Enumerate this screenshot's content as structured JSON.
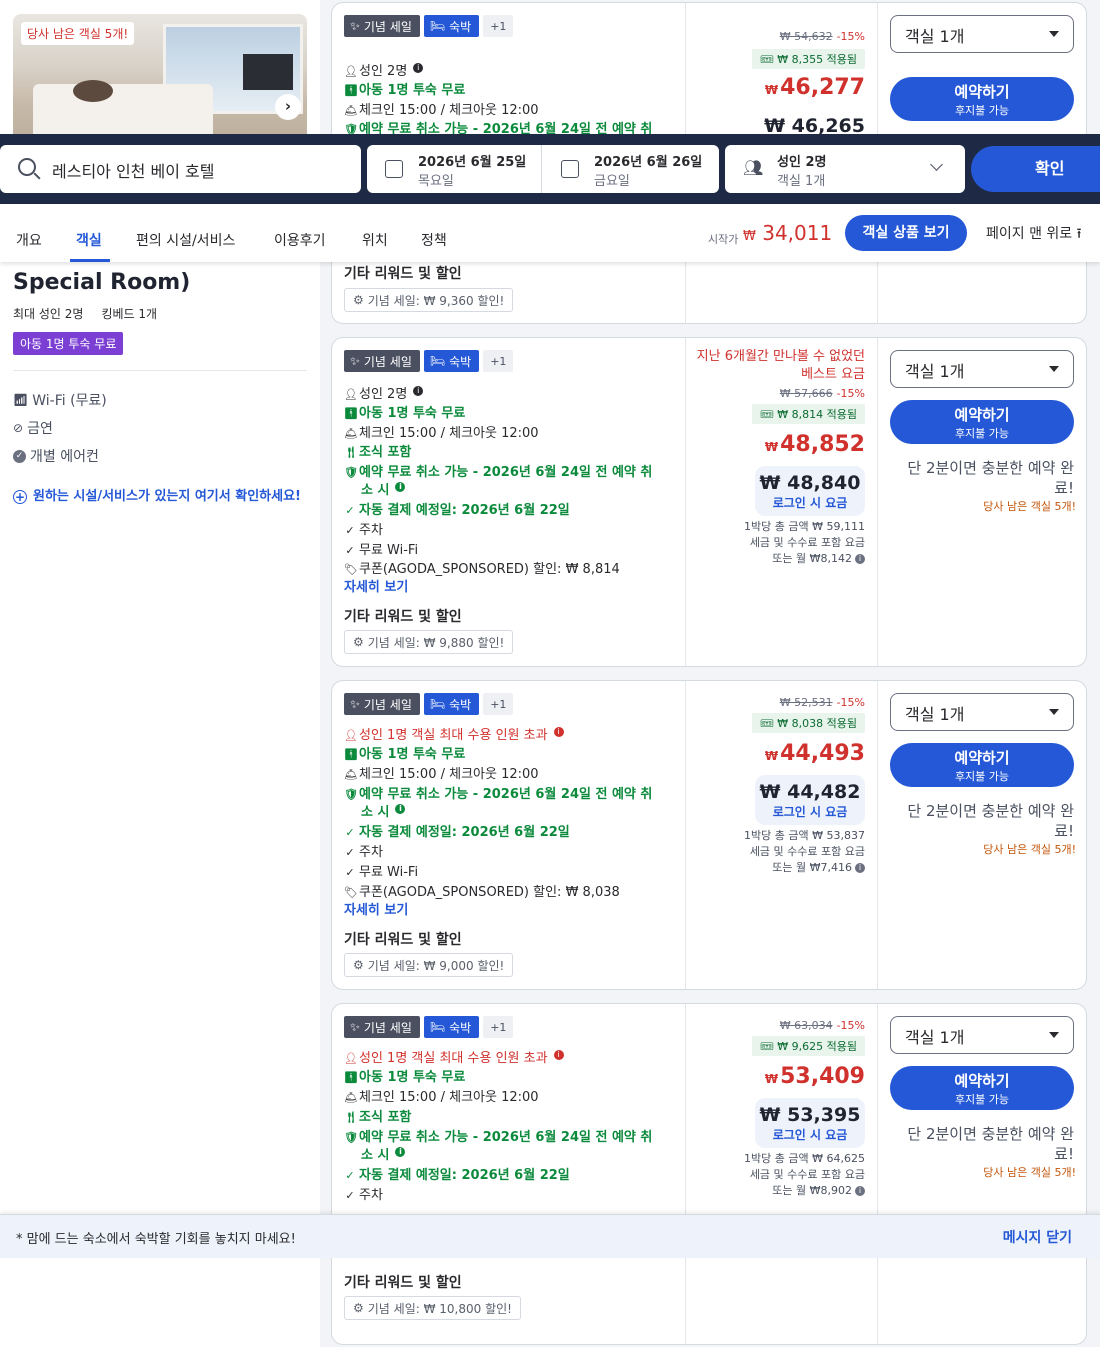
{
  "search": {
    "query": "레스티아 인천 베이 호텔",
    "checkin_date": "2026년 6월 25일",
    "checkin_day": "목요일",
    "checkout_date": "2026년 6월 26일",
    "checkout_day": "금요일",
    "guests": "성인 2명",
    "rooms": "객실 1개",
    "confirm": "확인"
  },
  "nav": {
    "tabs": [
      "개요",
      "객실",
      "편의 시설/서비스",
      "이용후기",
      "위치",
      "정책"
    ],
    "active_tab": "객실",
    "start_label": "시작가",
    "currency": "₩",
    "start_price": "34,011",
    "view_rooms": "객실 상품 보기",
    "back_top": "페이지 맨 위로"
  },
  "room": {
    "photo_badge": "당사 남은 객실 5개!",
    "name_tail": "Special Room)",
    "max_occupancy": "최대 성인 2명",
    "bed": "킹베드 1개",
    "child_tag": "아동 1명 투숙 무료",
    "amenities": [
      "Wi-Fi (무료)",
      "금연",
      "개별 에어컨"
    ],
    "amenity_prompt": "원하는 시설/서비스가 있는지 여기서 확인하세요!"
  },
  "common": {
    "badge_sale": "기념 세일",
    "badge_stay": "숙박",
    "badge_more": "+1",
    "select_label": "객실 1개",
    "book_label": "예약하기",
    "book_sub": "후지불 가능",
    "quick_label": "단 2분이면 충분한 예약 완료!",
    "remaining": "당사 남은 객실 5개!",
    "login_label": "로그인 시 요금",
    "tax_label": "세금 및 수수료 포함 요금",
    "details": "자세히 보기",
    "other_title": "기타 리워드 및 할인",
    "checkin": "체크인 15:00 / 체크아웃 12:00",
    "child_free": "아동 1명 투숙 무료",
    "breakfast": "조식 포함",
    "free_cancel": "예약 무료 취소 가능 - 2026년 6월 24일 전 예약 취",
    "free_cancel_2": "소 시",
    "auto_pay": "자동 결제 예정일: 2026년 6월 22일",
    "parking": "주차",
    "wifi": "무료 Wi-Fi",
    "adults_ok": "성인 2명",
    "adults_over": "성인 1명 객실 최대 수용 인원 초과"
  },
  "offers": [
    {
      "orig": "₩ 54,632",
      "pct": "-15%",
      "applied": "₩ 8,355 적용됨",
      "price": "46,277",
      "login_price": "₩ 46,265",
      "reward": "기념 세일: ₩ 9,360 할인!"
    },
    {
      "best_note": "지난 6개월간 만나볼 수 없었던 베스트 요금",
      "orig": "₩ 57,666",
      "pct": "-15%",
      "applied": "₩ 8,814 적용됨",
      "price": "48,852",
      "login_price": "₩ 48,840",
      "per_night": "1박당 총 금액 ₩ 59,111",
      "monthly": "또는 월 ₩8,142",
      "coupon": "쿠폰(AGODA_SPONSORED) 할인: ₩ 8,814",
      "reward": "기념 세일: ₩ 9,880 할인!"
    },
    {
      "orig": "₩ 52,531",
      "pct": "-15%",
      "applied": "₩ 8,038 적용됨",
      "price": "44,493",
      "login_price": "₩ 44,482",
      "per_night": "1박당 총 금액 ₩ 53,837",
      "monthly": "또는 월 ₩7,416",
      "coupon": "쿠폰(AGODA_SPONSORED) 할인: ₩ 8,038",
      "reward": "기념 세일: ₩ 9,000 할인!"
    },
    {
      "orig": "₩ 63,034",
      "pct": "-15%",
      "applied": "₩ 9,625 적용됨",
      "price": "53,409",
      "login_price": "₩ 53,395",
      "per_night": "1박당 총 금액 ₩ 64,625",
      "monthly": "또는 월 ₩8,902",
      "reward": "기념 세일: ₩ 10,800 할인!"
    }
  ],
  "footer_msg": {
    "text": "* 맘에 드는 숙소에서 숙박할 기회를 놓치지 마세요!",
    "close": "메시지 닫기"
  },
  "colors": {
    "brand_blue": "#2458d6",
    "price_red": "#d0312d",
    "green": "#0b8a3c",
    "navy": "#1e2a45",
    "purple": "#7b3fd4"
  }
}
